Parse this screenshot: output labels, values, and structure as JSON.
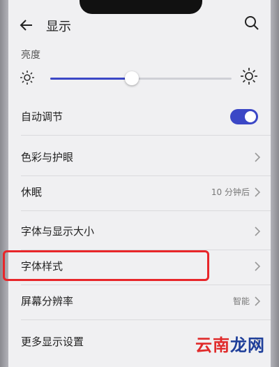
{
  "header": {
    "title": "显示"
  },
  "brightness": {
    "label": "亮度",
    "level_percent": 45,
    "accent": "#3b47c6"
  },
  "rows": [
    {
      "label": "自动调节",
      "value": "",
      "toggle": true
    },
    {
      "label": "色彩与护眼",
      "value": ""
    },
    {
      "label": "休眠",
      "value": "10 分钟后"
    },
    {
      "label": "字体与显示大小",
      "value": ""
    },
    {
      "label": "字体样式",
      "value": "",
      "highlighted": true
    },
    {
      "label": "屏幕分辨率",
      "value": "智能"
    },
    {
      "label": "更多显示设置",
      "value": ""
    }
  ],
  "highlight_color": "#e8262a",
  "watermark": {
    "part1": "云南",
    "part2": "龙网"
  }
}
